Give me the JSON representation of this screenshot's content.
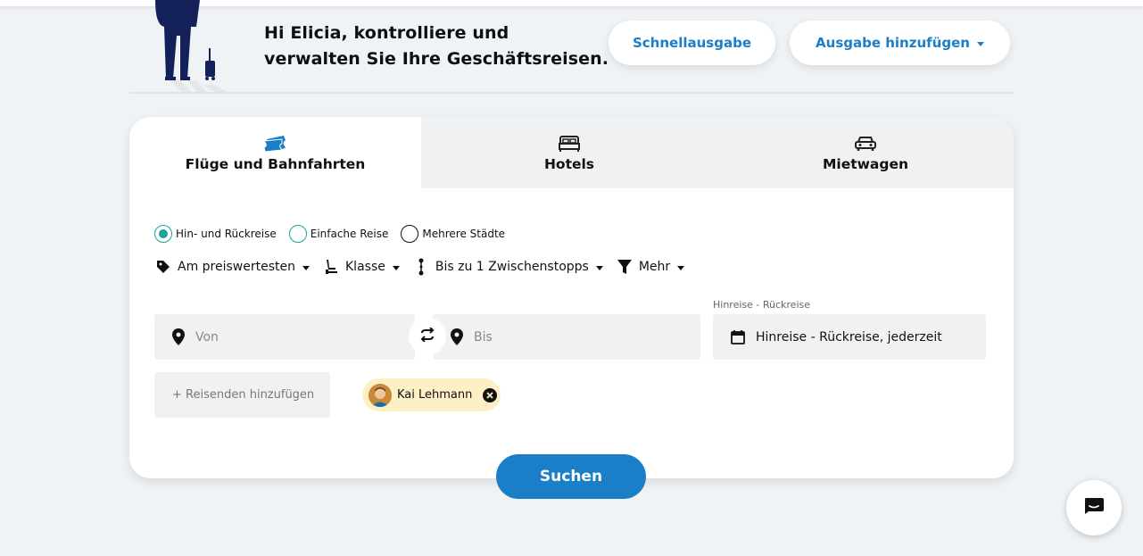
{
  "header": {
    "greeting_line1": "Hi Elicia, kontrolliere und",
    "greeting_line2": "verwalten Sie Ihre Geschäftsreisen.",
    "quick_expense_label": "Schnellausgabe",
    "add_expense_label": "Ausgabe hinzufügen"
  },
  "tabs": [
    {
      "label": "Flüge und Bahnfahrten",
      "icon": "ticket-icon",
      "active": true
    },
    {
      "label": "Hotels",
      "icon": "bed-icon",
      "active": false
    },
    {
      "label": "Mietwagen",
      "icon": "car-icon",
      "active": false
    }
  ],
  "trip_types": [
    {
      "label": "Hin- und Rückreise",
      "selected": true
    },
    {
      "label": "Einfache Reise",
      "selected": false
    },
    {
      "label": "Mehrere Städte",
      "selected": false
    }
  ],
  "filters": [
    {
      "label": "Am preiswertesten",
      "icon": "tag-icon"
    },
    {
      "label": "Klasse",
      "icon": "seat-icon"
    },
    {
      "label": "Bis zu 1 Zwischenstopps",
      "icon": "stops-icon"
    },
    {
      "label": "Mehr",
      "icon": "filter-icon"
    }
  ],
  "search": {
    "from_placeholder": "Von",
    "to_placeholder": "Bis",
    "date_label": "Hinreise - Rückreise",
    "date_value": "Hinreise - Rückreise, jederzeit",
    "add_traveler_label": "+ Reisenden hinzufügen",
    "traveler_name": "Kai Lehmann",
    "search_label": "Suchen"
  },
  "colors": {
    "primary": "#1a7ec8",
    "teal": "#1aa39a",
    "chip_bg": "#fdf0c4",
    "page_bg": "#eff3f6"
  }
}
